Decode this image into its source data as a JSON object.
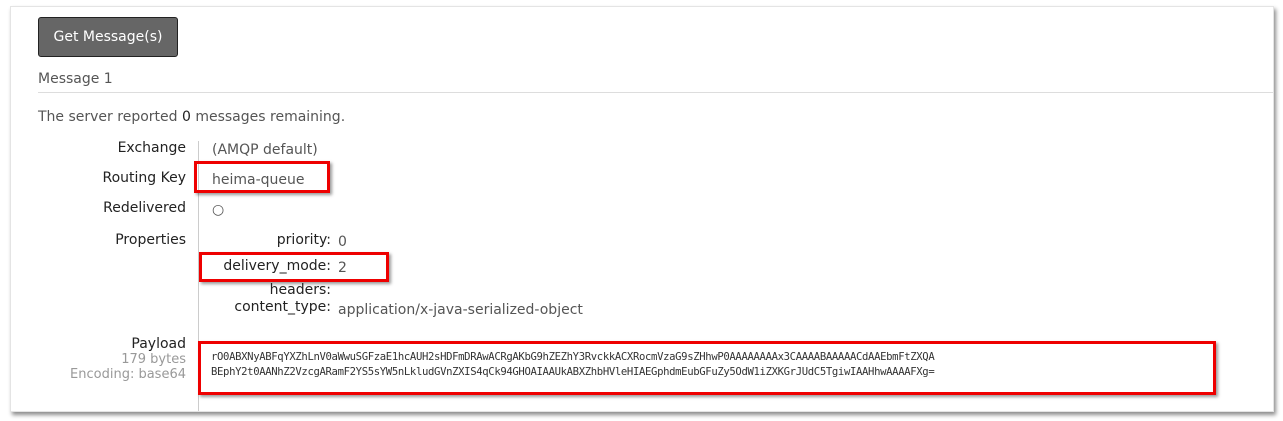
{
  "button": {
    "get_messages": "Get Message(s)"
  },
  "message": {
    "title": "Message 1",
    "remaining_prefix": "The server reported ",
    "remaining_count": "0",
    "remaining_suffix": " messages remaining.",
    "fields": {
      "exchange_label": "Exchange",
      "exchange_value": "(AMQP default)",
      "routing_key_label": "Routing Key",
      "routing_key_value": "heima-queue",
      "redelivered_label": "Redelivered",
      "redelivered_value": "○",
      "properties_label": "Properties"
    },
    "properties": [
      {
        "key": "priority:",
        "value": "0"
      },
      {
        "key": "delivery_mode:",
        "value": "2"
      },
      {
        "key": "headers:",
        "value": ""
      },
      {
        "key": "content_type:",
        "value": "application/x-java-serialized-object"
      }
    ],
    "payload": {
      "label": "Payload",
      "size": "179 bytes",
      "encoding": "Encoding: base64",
      "line1": "rO0ABXNyABFqYXZhLnV0aWwuSGFzaE1hcAUH2sHDFmDRAwACRgAKbG9hZEZhY3RvckkACXRocmVzaG9sZHhwP0AAAAAAAAx3CAAAABAAAAACdAAEbmFtZXQA",
      "line2": "BEphY2t0AANhZ2VzcgARamF2YS5sYW5nLkludGVnZXIS4qCk94GHOAIAAUkABXZhbHVleHIAEGphdmEubGFuZy5OdW1iZXKGrJUdC5TgiwIAAHhwAAAAFXg="
    }
  },
  "colors": {
    "highlight": "#e00000",
    "button_bg": "#666666"
  }
}
